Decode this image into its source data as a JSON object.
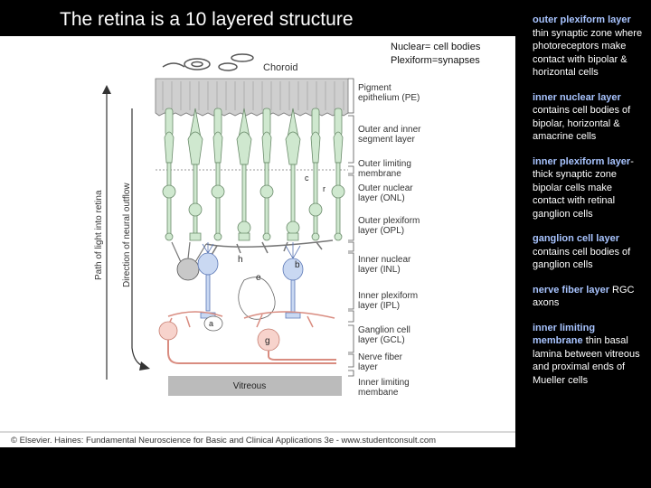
{
  "title": "The retina is a 10 layered structure",
  "note": {
    "line1": "Nuclear= cell bodies",
    "line2": "Plexiform=synapses"
  },
  "figure": {
    "choroid": "Choroid",
    "vitreous": "Vitreous",
    "axis_light": "Path of light into retina",
    "axis_outflow": "Direction of neural outflow",
    "cell_letters": {
      "c": "c",
      "r": "r",
      "h": "h",
      "b": "b",
      "a": "a",
      "e": "e",
      "g": "g"
    },
    "layer_labels": [
      [
        "Pigment",
        "epithelium (PE)"
      ],
      [
        "Outer and inner",
        "segment layer"
      ],
      [
        "Outer limiting",
        "membrane"
      ],
      [
        "Outer nuclear",
        "layer (ONL)"
      ],
      [
        "Outer plexiform",
        "layer (OPL)"
      ],
      [
        "Inner nuclear",
        "layer (INL)"
      ],
      [
        "Inner plexiform",
        "layer (IPL)"
      ],
      [
        "Ganglion cell",
        "layer (GCL)"
      ],
      [
        "Nerve fiber",
        "layer"
      ],
      [
        "Inner limiting",
        "membane"
      ]
    ],
    "copyright": "© Elsevier. Haines: Fundamental Neuroscience for Basic and Clinical Applications 3e - www.studentconsult.com"
  },
  "notes": [
    {
      "term": "outer plexiform layer",
      "text": " thin synaptic zone where photoreceptors make contact with bipolar & horizontal cells"
    },
    {
      "term": "inner nuclear layer",
      "text": " contains cell bodies of bipolar, horizontal & amacrine cells"
    },
    {
      "term": "inner plexiform layer",
      "text": "- thick synaptic zone bipolar cells make contact with retinal ganglion cells"
    },
    {
      "term": "ganglion cell layer",
      "text": " contains cell bodies of ganglion cells"
    },
    {
      "term": "nerve fiber layer",
      "text": " RGC axons"
    },
    {
      "term": "inner limiting membrane",
      "text": " thin basal lamina between vitreous and proximal ends of Mueller cells"
    }
  ],
  "colors": {
    "background": "#000000",
    "photoreceptor": "#cfe8cf",
    "bipolar_cell": "#c9d8f2",
    "ganglion_cell": "#f7d3cc",
    "horizontal_cell": "#c8c8c8",
    "pigment_epithelium": "#d0d0d0",
    "highlight_text": "#a8c4ff"
  }
}
